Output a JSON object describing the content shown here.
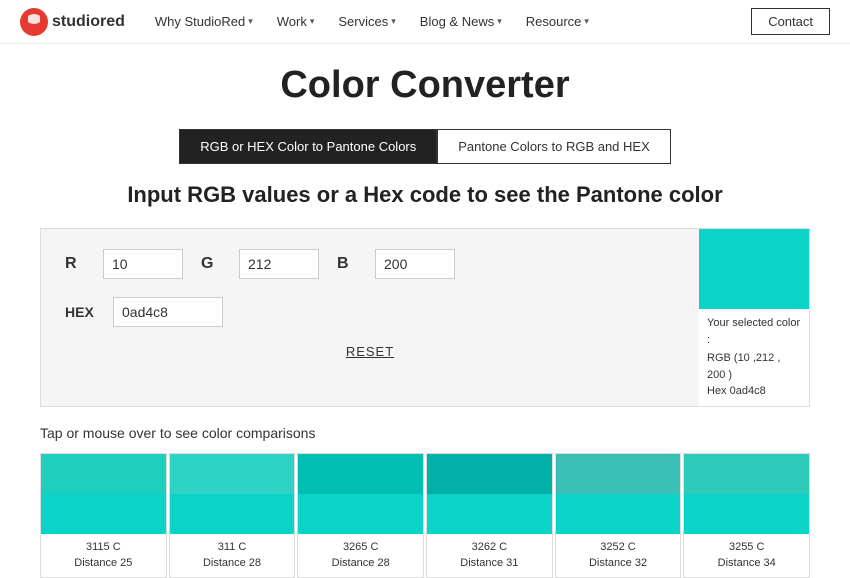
{
  "header": {
    "logo_text": "studiored",
    "nav": [
      {
        "label": "Why StudioRed",
        "has_dropdown": true
      },
      {
        "label": "Work",
        "has_dropdown": true
      },
      {
        "label": "Services",
        "has_dropdown": true
      },
      {
        "label": "Blog & News",
        "has_dropdown": true
      },
      {
        "label": "Resource",
        "has_dropdown": true
      }
    ],
    "contact_label": "Contact"
  },
  "page": {
    "title": "Color Converter",
    "subtitle": "Input RGB values or a Hex code to see the Pantone color"
  },
  "tabs": [
    {
      "label": "RGB or HEX Color to Pantone Colors",
      "active": true
    },
    {
      "label": "Pantone Colors to RGB and HEX",
      "active": false
    }
  ],
  "converter": {
    "r_label": "R",
    "g_label": "G",
    "b_label": "B",
    "r_value": "10",
    "g_value": "212",
    "b_value": "200",
    "hex_label": "HEX",
    "hex_value": "0ad4c8",
    "reset_label": "RESET",
    "color_preview": {
      "swatch_color": "#0ad4c8",
      "info_title": "Your selected color :",
      "rgb_label": "RGB",
      "rgb_value": "(10 ,212 , 200 )",
      "hex_label": "Hex",
      "hex_display": "0ad4c8"
    }
  },
  "comparisons": {
    "label": "Tap or mouse over to see color comparisons",
    "cards": [
      {
        "name": "3115 C",
        "distance": "Distance 25",
        "color_top": "#1ecfbe",
        "color_bottom": "#0ad4c8"
      },
      {
        "name": "311 C",
        "distance": "Distance 28",
        "color_top": "#2dd3c4",
        "color_bottom": "#0ad4c8"
      },
      {
        "name": "3265 C",
        "distance": "Distance 28",
        "color_top": "#00bfb2",
        "color_bottom": "#0ad4c8"
      },
      {
        "name": "3262 C",
        "distance": "Distance 31",
        "color_top": "#00b0a9",
        "color_bottom": "#0ad4c8"
      },
      {
        "name": "3252 C",
        "distance": "Distance 32",
        "color_top": "#3bbfb5",
        "color_bottom": "#0ad4c8"
      },
      {
        "name": "3255 C",
        "distance": "Distance 34",
        "color_top": "#2ecbba",
        "color_bottom": "#0ad4c8"
      }
    ]
  }
}
